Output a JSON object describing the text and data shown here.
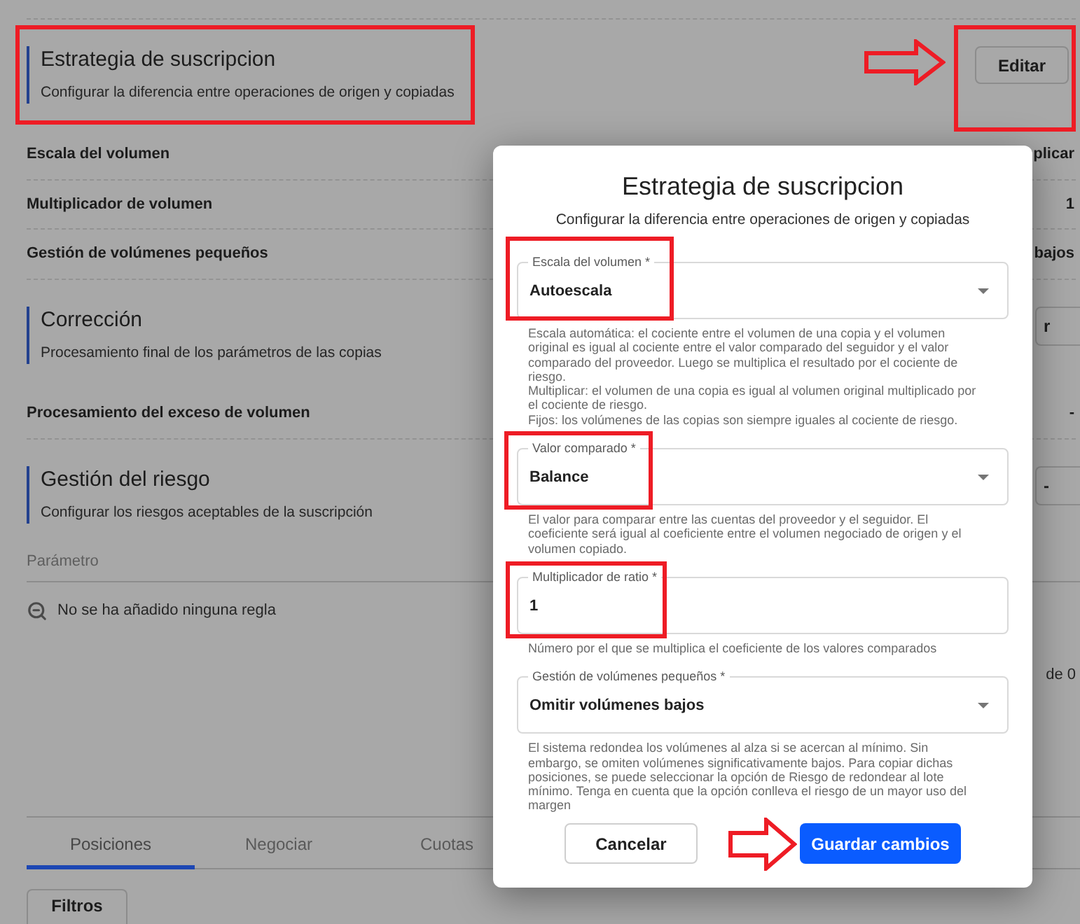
{
  "page": {
    "sections": [
      {
        "title": "Estrategia de suscripcion",
        "subtitle": "Configurar la diferencia entre operaciones de origen y copiadas",
        "action": "Editar",
        "rows": [
          {
            "label": "Escala del volumen",
            "value": "plicar"
          },
          {
            "label": "Multiplicador de volumen",
            "value": "1"
          },
          {
            "label": "Gestión de volúmenes pequeños",
            "value": "bajos"
          }
        ]
      },
      {
        "title": "Corrección",
        "subtitle": "Procesamiento final de los parámetros de las copias",
        "action": "r",
        "rows": [
          {
            "label": "Procesamiento del exceso de volumen",
            "value": "-"
          }
        ]
      },
      {
        "title": "Gestión del riesgo",
        "subtitle": "Configurar los riesgos aceptables de la suscripción",
        "action": "-",
        "table": {
          "columns": [
            "Parámetro"
          ],
          "empty_message": "No se ha añadido ninguna regla",
          "pagination": "de 0"
        }
      }
    ],
    "tabs": [
      {
        "label": "Posiciones",
        "selected": true
      },
      {
        "label": "Negociar",
        "selected": false
      },
      {
        "label": "Cuotas",
        "selected": false
      }
    ],
    "filter_button": "Filtros"
  },
  "dialog": {
    "title": "Estrategia de suscripcion",
    "subtitle": "Configurar la diferencia entre operaciones de origen y copiadas",
    "fields": [
      {
        "kind": "select",
        "label": "Escala del volumen *",
        "value": "Autoescala",
        "help": [
          "Escala automática: el cociente entre el volumen de una copia y el volumen original es igual al cociente entre el valor comparado del seguidor y el valor comparado del proveedor. Luego se multiplica el resultado por el cociente de riesgo.",
          "Multiplicar: el volumen de una copia es igual al volumen original multiplicado por el cociente de riesgo.",
          "Fijos: los volúmenes de las copias son siempre iguales al cociente de riesgo."
        ]
      },
      {
        "kind": "select",
        "label": "Valor comparado *",
        "value": "Balance",
        "help": [
          "El valor para comparar entre las cuentas del proveedor y el seguidor. El coeficiente será igual al coeficiente entre el volumen negociado de origen y el volumen copiado."
        ]
      },
      {
        "kind": "text",
        "label": "Multiplicador de ratio *",
        "value": "1",
        "help": [
          "Número por el que se multiplica el coeficiente de los valores comparados"
        ]
      },
      {
        "kind": "select",
        "label": "Gestión de volúmenes pequeños *",
        "value": "Omitir volúmenes bajos",
        "help": [
          "El sistema redondea los volúmenes al alza si se acercan al mínimo. Sin embargo, se omiten volúmenes significativamente bajos. Para copiar dichas posiciones, se puede seleccionar la opción de Riesgo de redondear al lote mínimo. Tenga en cuenta que la opción conlleva el riesgo de un mayor uso del margen"
        ]
      }
    ],
    "buttons": [
      {
        "kind": "secondary",
        "label": "Cancelar"
      },
      {
        "kind": "primary",
        "label": "Guardar cambios"
      }
    ]
  }
}
